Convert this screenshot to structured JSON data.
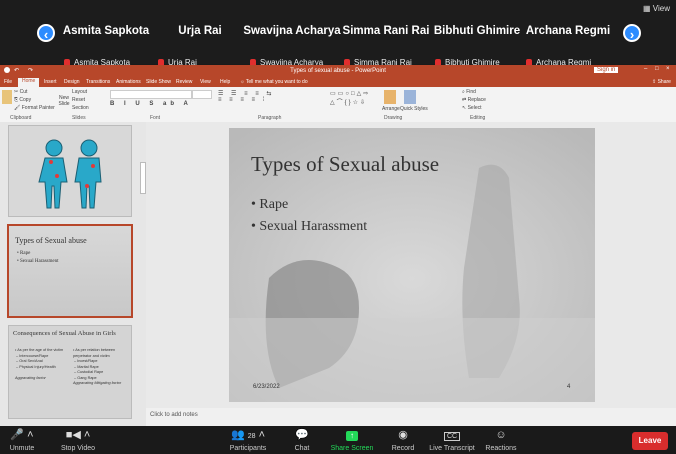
{
  "zoom": {
    "view_label": "View",
    "participants_tiles": [
      {
        "name": "Asmita Sapkota",
        "label": "Asmita Sapkota"
      },
      {
        "name": "Urja Rai",
        "label": "Urja Rai"
      },
      {
        "name": "Swavijna Acharya",
        "label": "Swavijna Acharya"
      },
      {
        "name": "Simma Rani Rai",
        "label": "Simma Rani Rai"
      },
      {
        "name": "Bibhuti Ghimire",
        "label": "Bibhuti Ghimire"
      },
      {
        "name": "Archana Regmi",
        "label": "Archana Regmi"
      }
    ],
    "toolbar": {
      "unmute": "Unmute",
      "stop_video": "Stop Video",
      "participants": "Participants",
      "participants_count": "28",
      "chat": "Chat",
      "share_screen": "Share Screen",
      "record": "Record",
      "live_transcript": "Live Transcript",
      "reactions": "Reactions",
      "leave": "Leave"
    }
  },
  "ppt": {
    "window_title": "Types of sexual abuse - PowerPoint",
    "tabs": [
      "File",
      "Home",
      "Insert",
      "Design",
      "Transitions",
      "Animations",
      "Slide Show",
      "Review",
      "View",
      "Help",
      "Tell me what you want to do"
    ],
    "ribbon_groups": [
      "Clipboard",
      "Slides",
      "Font",
      "Paragraph",
      "Drawing",
      "Editing"
    ],
    "ribbon_items": {
      "cut": "Cut",
      "copy": "Copy",
      "format_painter": "Format Painter",
      "new_slide": "New Slide",
      "layout": "Layout",
      "reset": "Reset",
      "section": "Section",
      "arrange": "Arrange",
      "quick_styles": "Quick Styles",
      "find": "Find",
      "replace": "Replace",
      "select": "Select"
    },
    "thumbnails": [
      {
        "num": "",
        "title": ""
      },
      {
        "num": "",
        "title": "Types of Sexual abuse",
        "bullets": [
          "Rape",
          "Sexual Harassment"
        ]
      },
      {
        "num": "",
        "title": "Consequences of Sexual Abuse in Girls",
        "col1": [
          "As per the age of the victim",
          "Intercourse/Rape",
          "Oral Sex/Anal",
          "Physical Injury/Health",
          "Aggravating factor"
        ],
        "col2": [
          "As per relation between perpetrator and victim",
          "Incest/Rape",
          "Marital Rape",
          "Custodial Rape",
          "Gang Rape",
          "Aggravating Mitigating factor"
        ]
      }
    ],
    "slide": {
      "title": "Types of Sexual abuse",
      "bullets": [
        "Rape",
        "Sexual Harassment"
      ],
      "date": "6/23/2022",
      "number": "4"
    },
    "notes_placeholder": "Click to add notes"
  },
  "colors": {
    "ppt_accent": "#b7472a",
    "zoom_blue": "#2d8cff",
    "leave_red": "#d92d2d",
    "share_green": "#23d959"
  }
}
